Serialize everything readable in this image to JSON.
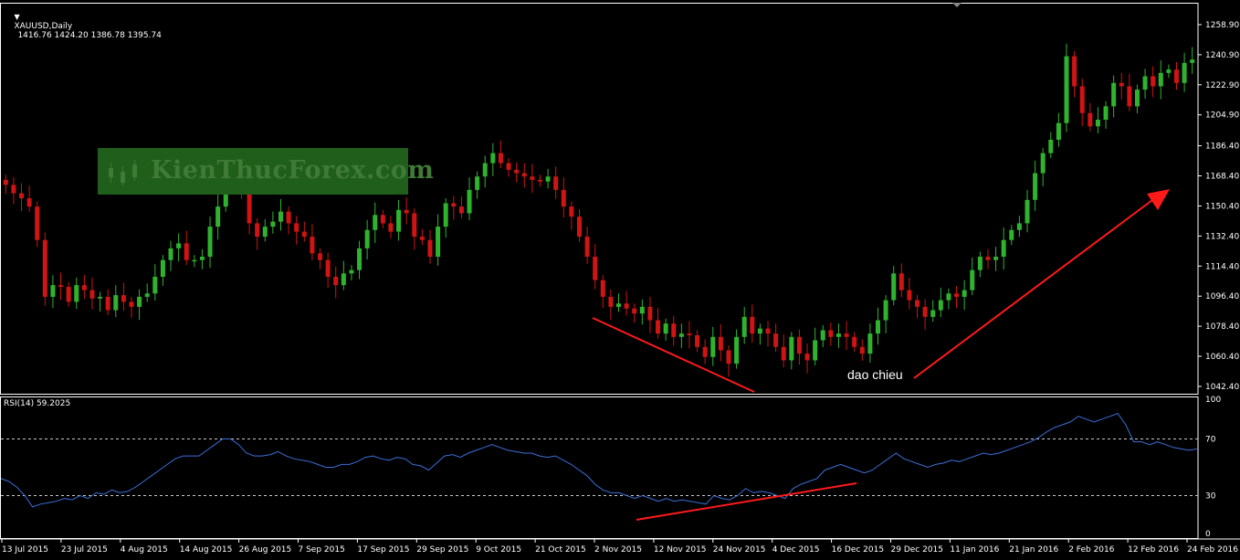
{
  "header": {
    "symbol": "XAUUSD,Daily",
    "ohlc": "1416.76 1424.20 1386.78 1395.74"
  },
  "rsi_header": "RSI(14) 59.2025",
  "watermark": "KienThucForex.com",
  "annotation": "dao chieu",
  "colors": {
    "background": "#000000",
    "bull_candle": "#2fb32f",
    "bear_candle": "#d01414",
    "rsi_line": "#3a6fd8",
    "trend_line": "#ff1a1a",
    "axis": "#ffffff",
    "level_line": "#c8c8c8"
  },
  "chart_data": [
    {
      "type": "candlestick",
      "symbol": "XAUUSD",
      "timeframe": "Daily",
      "y_ticks": [
        1042.4,
        1060.4,
        1078.4,
        1096.4,
        1114.4,
        1132.4,
        1150.4,
        1168.4,
        1186.4,
        1204.9,
        1222.9,
        1240.9,
        1258.9
      ],
      "ylim": [
        1038,
        1272
      ],
      "x_ticks": [
        "13 Jul 2015",
        "23 Jul 2015",
        "4 Aug 2015",
        "14 Aug 2015",
        "26 Aug 2015",
        "7 Sep 2015",
        "17 Sep 2015",
        "29 Sep 2015",
        "9 Oct 2015",
        "21 Oct 2015",
        "2 Nov 2015",
        "12 Nov 2015",
        "24 Nov 2015",
        "4 Dec 2015",
        "16 Dec 2015",
        "29 Dec 2015",
        "11 Jan 2016",
        "21 Jan 2016",
        "2 Feb 2016",
        "12 Feb 2016",
        "24 Feb 2016"
      ],
      "closes": [
        1163,
        1158,
        1155,
        1150,
        1130,
        1096,
        1103,
        1102,
        1093,
        1103,
        1100,
        1095,
        1096,
        1088,
        1097,
        1093,
        1090,
        1096,
        1098,
        1108,
        1118,
        1125,
        1128,
        1118,
        1118,
        1120,
        1138,
        1150,
        1162,
        1167,
        1160,
        1140,
        1132,
        1138,
        1141,
        1147,
        1140,
        1135,
        1132,
        1122,
        1118,
        1108,
        1103,
        1110,
        1112,
        1125,
        1136,
        1145,
        1140,
        1135,
        1148,
        1146,
        1132,
        1130,
        1120,
        1138,
        1152,
        1150,
        1146,
        1160,
        1168,
        1176,
        1182,
        1176,
        1172,
        1170,
        1168,
        1166,
        1165,
        1168,
        1160,
        1150,
        1144,
        1132,
        1120,
        1106,
        1096,
        1090,
        1092,
        1089,
        1086,
        1090,
        1082,
        1074,
        1080,
        1072,
        1074,
        1073,
        1066,
        1060,
        1072,
        1064,
        1056,
        1072,
        1084,
        1074,
        1077,
        1074,
        1066,
        1058,
        1072,
        1062,
        1058,
        1070,
        1076,
        1072,
        1074,
        1072,
        1066,
        1062,
        1074,
        1082,
        1094,
        1110,
        1100,
        1094,
        1090,
        1084,
        1088,
        1094,
        1098,
        1096,
        1100,
        1112,
        1120,
        1118,
        1120,
        1130,
        1136,
        1140,
        1154,
        1170,
        1182,
        1190,
        1200,
        1240,
        1222,
        1206,
        1198,
        1202,
        1210,
        1224,
        1222,
        1210,
        1220,
        1228,
        1222,
        1230,
        1232,
        1224,
        1236,
        1238
      ],
      "trend_lines": [
        "price support line (falling)",
        "price arrow (rising)"
      ]
    },
    {
      "type": "line",
      "indicator": "RSI(14)",
      "current_value": 59.2025,
      "y_ticks": [
        0,
        30,
        70,
        100
      ],
      "ylim": [
        0,
        100
      ],
      "levels": [
        30,
        70
      ],
      "values": [
        42,
        40,
        36,
        30,
        22,
        24,
        25,
        26,
        28,
        27,
        30,
        28,
        32,
        31,
        34,
        32,
        33,
        36,
        40,
        44,
        48,
        52,
        56,
        58,
        58,
        58,
        62,
        66,
        70,
        70,
        66,
        60,
        58,
        58,
        59,
        61,
        58,
        56,
        55,
        54,
        52,
        50,
        50,
        52,
        52,
        54,
        57,
        58,
        56,
        55,
        57,
        56,
        52,
        51,
        48,
        53,
        58,
        59,
        57,
        60,
        62,
        64,
        66,
        64,
        62,
        61,
        60,
        60,
        58,
        57,
        58,
        55,
        52,
        48,
        44,
        38,
        34,
        32,
        32,
        30,
        28,
        30,
        28,
        26,
        28,
        26,
        27,
        26,
        25,
        24,
        30,
        28,
        27,
        30,
        35,
        32,
        33,
        32,
        30,
        28,
        35,
        38,
        40,
        42,
        48,
        50,
        52,
        50,
        48,
        46,
        48,
        52,
        56,
        60,
        56,
        54,
        52,
        50,
        52,
        53,
        55,
        54,
        56,
        58,
        60,
        59,
        60,
        62,
        64,
        66,
        68,
        71,
        75,
        78,
        80,
        82,
        86,
        84,
        82,
        84,
        86,
        88,
        80,
        68,
        68,
        66,
        68,
        66,
        64,
        63,
        62,
        63
      ]
    }
  ]
}
